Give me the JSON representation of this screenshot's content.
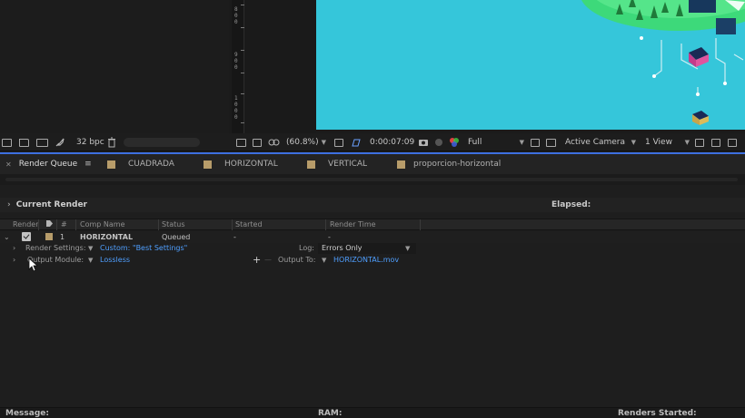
{
  "toolbar": {
    "bit_depth": "32 bpc",
    "zoom": "(60.8%)",
    "timecode": "0:00:07:09",
    "resolution": "Full",
    "camera": "Active Camera",
    "view": "1 View"
  },
  "ruler": {
    "group_a": [
      "8",
      "0",
      "0"
    ],
    "group_b": [
      "9",
      "0",
      "0"
    ],
    "group_c": [
      "1",
      "0",
      "0",
      "0"
    ]
  },
  "tabs": [
    {
      "label": "Render Queue"
    },
    {
      "label": "CUADRADA"
    },
    {
      "label": "HORIZONTAL"
    },
    {
      "label": "VERTICAL"
    },
    {
      "label": "proporcion-horizontal"
    }
  ],
  "current_render": {
    "label": "Current Render",
    "elapsed_label": "Elapsed:"
  },
  "table": {
    "columns": [
      "Render",
      "#",
      "Comp Name",
      "Status",
      "Started",
      "Render Time"
    ],
    "row": {
      "number": "1",
      "comp_name": "HORIZONTAL",
      "status": "Queued",
      "started": "-",
      "render_time": "-"
    },
    "render_settings": {
      "label": "Render Settings:",
      "value": "Custom: \"Best Settings\"",
      "log_label": "Log:",
      "log_value": "Errors Only"
    },
    "output_module": {
      "label": "Output Module:",
      "value": "Lossless",
      "add": "+",
      "remove": "—",
      "output_to_label": "Output To:",
      "output_to_value": "HORIZONTAL.mov"
    }
  },
  "status_bar": {
    "message_label": "Message:",
    "ram_label": "RAM:",
    "renders_started_label": "Renders Started:"
  },
  "colors": {
    "composition_bg": "#35c6da",
    "accent_blue": "#3d6fe0",
    "link_blue": "#4f9fff",
    "label_swatch": "#b79c6a"
  }
}
